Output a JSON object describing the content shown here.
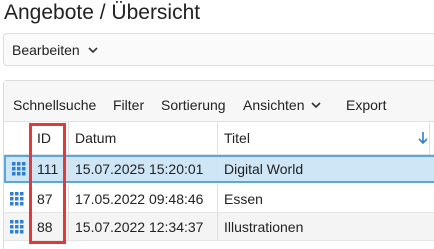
{
  "page": {
    "title": "Angebote / Übersicht"
  },
  "actions": {
    "edit_label": "Bearbeiten"
  },
  "toolbar": {
    "items": [
      "Schnellsuche",
      "Filter",
      "Sortierung",
      "Ansichten",
      "Export"
    ]
  },
  "table": {
    "columns": [
      "ID",
      "Datum",
      "Titel"
    ],
    "sort_column": "Titel",
    "sort_direction": "descending",
    "rows": [
      {
        "id": "111",
        "date": "15.07.2025 15:20:01",
        "title": "Digital World",
        "selected": true
      },
      {
        "id": "87",
        "date": "17.05.2022 09:48:46",
        "title": "Essen",
        "selected": false
      },
      {
        "id": "88",
        "date": "15.07.2022 12:34:37",
        "title": "Illustrationen",
        "selected": false
      }
    ]
  },
  "icons": {
    "row_icon": "grid-dots-icon",
    "dropdown": "chevron-down-icon",
    "sort": "arrow-down-icon"
  },
  "colors": {
    "selected_row": "#cfe6f7",
    "selected_border": "#5aa6df",
    "accent": "#2f7fd1",
    "highlight": "#e03a3a"
  }
}
